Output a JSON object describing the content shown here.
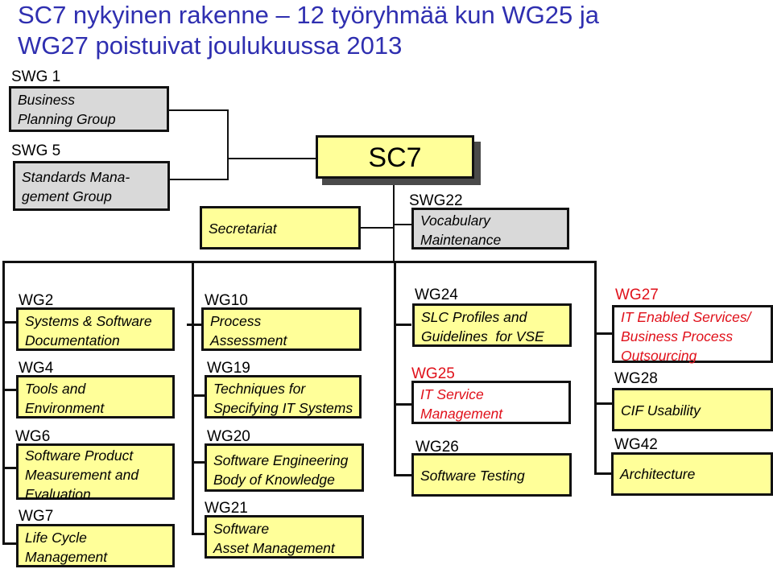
{
  "title": {
    "line1": "SC7 nykyinen rakenne – 12 työryhmää kun WG25 ja",
    "line2": "WG27 poistuivat joulukuussa 2013"
  },
  "colors": {
    "title": "#2f2fb0",
    "box_fill": "#ffff99",
    "subgroup_fill": "#d9d9d9",
    "removed_text": "#e0101a"
  },
  "top": {
    "swg1": {
      "id": "SWG 1",
      "name": "Business\nPlanning Group"
    },
    "swg5": {
      "id": "SWG 5",
      "name": "Standards Mana-\ngement Group"
    },
    "sc7": {
      "name": "SC7"
    },
    "secretariat": {
      "name": "Secretariat"
    },
    "swg22": {
      "id": "SWG22",
      "name": "Vocabulary\nMaintenance"
    }
  },
  "columns": [
    {
      "groups": [
        {
          "id": "WG2",
          "name": "Systems & Software\nDocumentation",
          "removed": false
        },
        {
          "id": "WG4",
          "name": "Tools and\nEnvironment",
          "removed": false
        },
        {
          "id": "WG6",
          "name": "Software Product\nMeasurement and\nEvaluation",
          "removed": false
        },
        {
          "id": "WG7",
          "name": "Life Cycle\nManagement",
          "removed": false
        }
      ]
    },
    {
      "groups": [
        {
          "id": "WG10",
          "name": "Process\nAssessment",
          "removed": false
        },
        {
          "id": "WG19",
          "name": "Techniques for\nSpecifying IT Systems",
          "removed": false
        },
        {
          "id": "WG20",
          "name": "Software Engineering\nBody of Knowledge",
          "removed": false
        },
        {
          "id": "WG21",
          "name": "Software\nAsset Management",
          "removed": false
        }
      ]
    },
    {
      "groups": [
        {
          "id": "WG24",
          "name": "SLC Profiles and\nGuidelines  for VSE",
          "removed": false
        },
        {
          "id": "WG25",
          "name": "IT Service\nManagement",
          "removed": true
        },
        {
          "id": "WG26",
          "name": "Software Testing",
          "removed": false
        }
      ]
    },
    {
      "groups": [
        {
          "id": "WG27",
          "name": "IT Enabled Services/\nBusiness Process\nOutsourcing",
          "removed": true
        },
        {
          "id": "WG28",
          "name": "CIF Usability",
          "removed": false
        },
        {
          "id": "WG42",
          "name": "Architecture",
          "removed": false
        }
      ]
    }
  ]
}
